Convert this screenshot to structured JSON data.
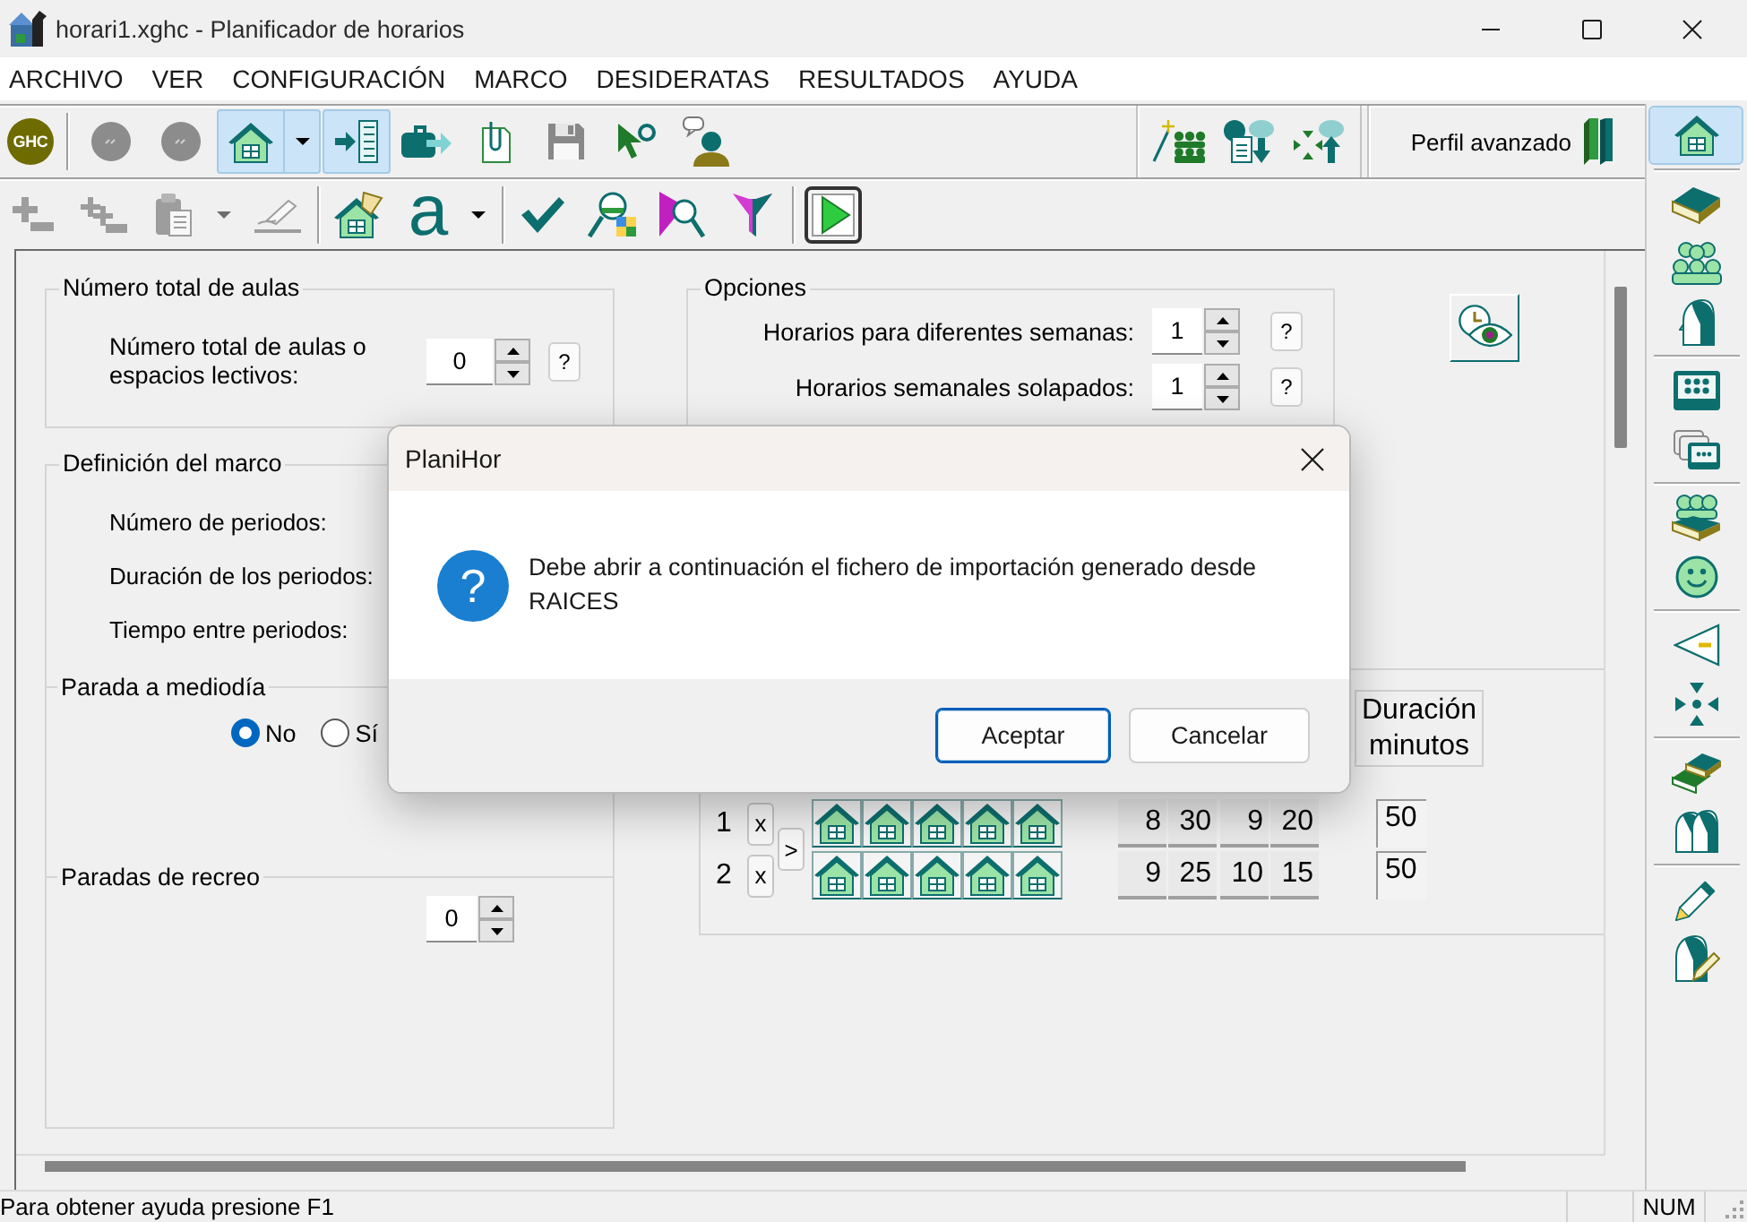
{
  "window": {
    "title": "horari1.xghc - Planificador de horarios"
  },
  "menu": [
    "ARCHIVO",
    "VER",
    "CONFIGURACIÓN",
    "MARCO",
    "DESIDERATAS",
    "RESULTADOS",
    "AYUDA"
  ],
  "toolbar_1": {
    "groups": [
      {
        "buttons": [
          {
            "kind": "logo",
            "label": "GHC",
            "selected": false,
            "disabled": false,
            "menu": false
          }
        ]
      },
      {
        "buttons": [
          {
            "kind": "icon",
            "selected": false,
            "disabled": true,
            "menu": false
          },
          {
            "kind": "icon",
            "selected": false,
            "disabled": true,
            "menu": false
          },
          {
            "kind": "icon",
            "selected": true,
            "disabled": false,
            "menu": true
          },
          {
            "kind": "icon",
            "selected": true,
            "disabled": false,
            "menu": false
          },
          {
            "kind": "icon",
            "selected": false,
            "disabled": false,
            "menu": false
          },
          {
            "kind": "icon",
            "selected": false,
            "disabled": false,
            "menu": false
          },
          {
            "kind": "icon",
            "selected": false,
            "disabled": true,
            "menu": false
          },
          {
            "kind": "icon",
            "selected": false,
            "disabled": false,
            "menu": false
          },
          {
            "kind": "icon",
            "selected": false,
            "disabled": false,
            "menu": false
          }
        ]
      }
    ],
    "quick_buttons": [
      {
        "kind": "icon",
        "selected": false,
        "disabled": false,
        "menu": false
      },
      {
        "kind": "icon",
        "selected": false,
        "disabled": false,
        "menu": false
      },
      {
        "kind": "icon",
        "selected": false,
        "disabled": false,
        "menu": false
      }
    ],
    "profile": {
      "label": "Perfil avanzado"
    }
  },
  "toolbar_2": {
    "groups": [
      {
        "buttons": [
          {
            "kind": "icon",
            "selected": false,
            "disabled": true,
            "menu": false
          },
          {
            "kind": "icon",
            "selected": false,
            "disabled": true,
            "menu": false
          },
          {
            "kind": "icon",
            "selected": false,
            "disabled": true,
            "menu": true
          },
          {
            "kind": "icon",
            "selected": false,
            "disabled": true,
            "menu": false
          }
        ]
      },
      {
        "buttons": [
          {
            "kind": "icon",
            "selected": false,
            "disabled": false,
            "menu": false
          },
          {
            "kind": "letter",
            "label": "a",
            "selected": false,
            "disabled": false,
            "menu": true
          }
        ]
      },
      {
        "buttons": [
          {
            "kind": "icon",
            "selected": false,
            "disabled": false,
            "menu": false
          },
          {
            "kind": "icon",
            "selected": false,
            "disabled": false,
            "menu": false
          },
          {
            "kind": "icon",
            "selected": false,
            "disabled": false,
            "menu": false
          },
          {
            "kind": "icon",
            "selected": false,
            "disabled": false,
            "menu": false
          }
        ]
      },
      {
        "buttons": [
          {
            "kind": "icon",
            "selected": false,
            "disabled": false,
            "menu": false
          }
        ]
      }
    ]
  },
  "sidebar": {
    "groups": [
      {
        "buttons": [
          {
            "selected": true
          }
        ]
      },
      {
        "buttons": [
          {
            "selected": false
          },
          {
            "selected": false
          },
          {
            "selected": false
          }
        ]
      },
      {
        "buttons": [
          {
            "selected": false
          },
          {
            "selected": false
          }
        ]
      },
      {
        "buttons": [
          {
            "selected": false
          },
          {
            "selected": false
          }
        ]
      },
      {
        "buttons": [
          {
            "selected": false
          },
          {
            "selected": false
          }
        ]
      },
      {
        "buttons": [
          {
            "selected": false
          },
          {
            "selected": false
          }
        ]
      },
      {
        "buttons": [
          {
            "selected": false
          },
          {
            "selected": false
          }
        ]
      }
    ]
  },
  "classrooms": {
    "title": "Número total de aulas",
    "label": "Número total de aulas o espacios lectivos:",
    "value": "0",
    "help": "?"
  },
  "frame": {
    "title": "Definición del marco",
    "fields": [
      "Número de periodos:",
      "Duración de los periodos:",
      "Tiempo entre periodos:"
    ]
  },
  "midday_break": {
    "title": "Parada a mediodía",
    "options": [
      {
        "label": "No",
        "selected": true
      },
      {
        "label": "Sí",
        "selected": false
      }
    ]
  },
  "recess_breaks": {
    "title": "Paradas de recreo",
    "value": "0"
  },
  "options": {
    "title": "Opciones",
    "rows": [
      {
        "label": "Horarios para diferentes semanas:",
        "value": "1",
        "help": "?"
      },
      {
        "label": "Horarios semanales solapados:",
        "value": "1",
        "help": "?"
      }
    ]
  },
  "periods": {
    "columns": [
      "Duración minutos"
    ],
    "move_button": ">",
    "rows": [
      {
        "number": "1",
        "remove": "x",
        "days": [
          {
            "on": true
          },
          {
            "on": true
          },
          {
            "on": true
          },
          {
            "on": true
          },
          {
            "on": true
          }
        ],
        "times": [
          "8",
          "30",
          "9",
          "20"
        ],
        "duration": "50"
      },
      {
        "number": "2",
        "remove": "x",
        "days": [
          {
            "on": true
          },
          {
            "on": true
          },
          {
            "on": true
          },
          {
            "on": true
          },
          {
            "on": true
          }
        ],
        "times": [
          "9",
          "25",
          "10",
          "15"
        ],
        "duration": "50"
      }
    ]
  },
  "dialog": {
    "title": "PlaniHor",
    "icon": "?",
    "message": "Debe abrir a continuación el fichero de importación generado desde RAICES",
    "buttons": [
      {
        "label": "Aceptar",
        "default": true
      },
      {
        "label": "Cancelar",
        "default": false
      }
    ]
  },
  "status_bar": {
    "text": "Para obtener ayuda presione F1",
    "indicators": [
      "NUM"
    ]
  }
}
